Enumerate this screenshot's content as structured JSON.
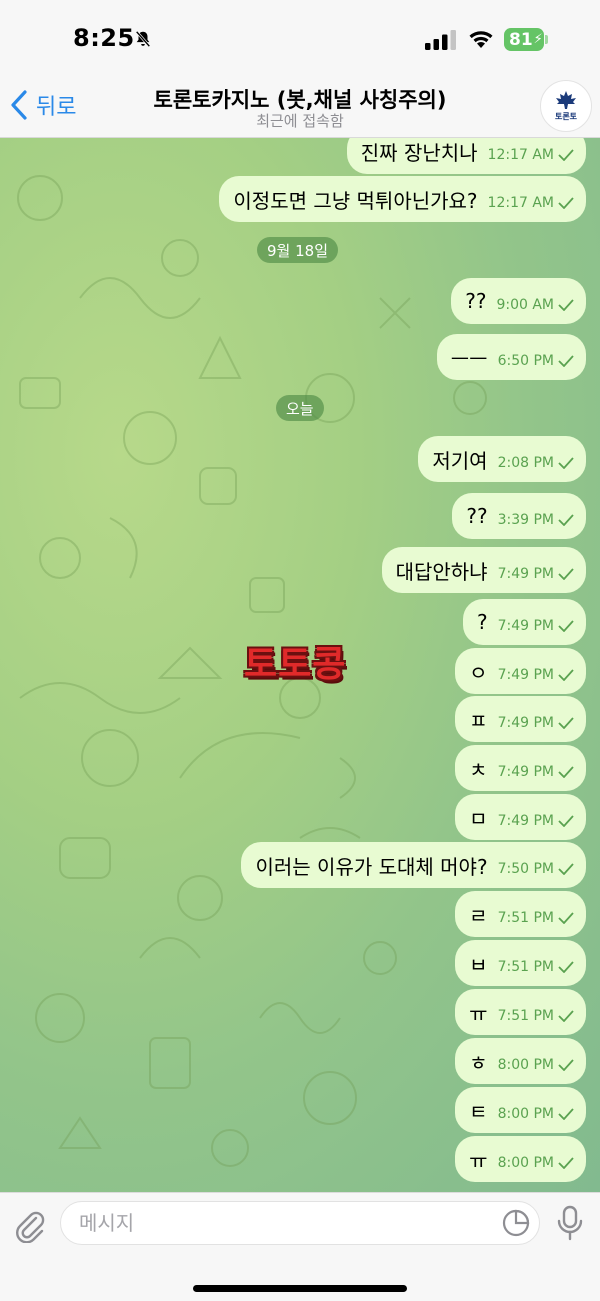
{
  "status_bar": {
    "time": "8:25",
    "battery": "81",
    "icons": [
      "bell-slash-icon",
      "cellular-signal-icon",
      "wifi-icon",
      "battery-icon",
      "charging-bolt-icon"
    ]
  },
  "header": {
    "back_label": "뒤로",
    "title": "토론토카지노 (봇,채널 사칭주의)",
    "status": "최근에 접속함",
    "avatar_text": "토론토"
  },
  "colors": {
    "accent": "#2a89e8",
    "bubble_out": "#e8fbd2",
    "meta_text": "#5aa250",
    "date_chip": "#6a9e5e",
    "sticker_red": "#e02a2a"
  },
  "chat": {
    "date_separators": [
      {
        "label": "9월 18일"
      },
      {
        "label": "오늘"
      }
    ],
    "sticker_text": "토토콩",
    "messages": [
      {
        "text": "진짜 장난치나",
        "time": "12:17 AM",
        "read": true
      },
      {
        "text": "이정도면 그냥 먹튀아닌가요?",
        "time": "12:17 AM",
        "read": true
      },
      {
        "text": "??",
        "time": "9:00 AM",
        "read": true
      },
      {
        "text": "ㅡㅡ",
        "time": "6:50 PM",
        "read": true
      },
      {
        "text": "저기여",
        "time": "2:08 PM",
        "read": true
      },
      {
        "text": "??",
        "time": "3:39 PM",
        "read": true
      },
      {
        "text": "대답안하냐",
        "time": "7:49 PM",
        "read": true
      },
      {
        "text": "?",
        "time": "7:49 PM",
        "read": true
      },
      {
        "text": "ㅇ",
        "time": "7:49 PM",
        "read": true
      },
      {
        "text": "ㅍ",
        "time": "7:49 PM",
        "read": true
      },
      {
        "text": "ㅊ",
        "time": "7:49 PM",
        "read": true
      },
      {
        "text": "ㅁ",
        "time": "7:49 PM",
        "read": true
      },
      {
        "text": "이러는 이유가 도대체 머야?",
        "time": "7:50 PM",
        "read": true
      },
      {
        "text": "ㄹ",
        "time": "7:51 PM",
        "read": true
      },
      {
        "text": "ㅂ",
        "time": "7:51 PM",
        "read": true
      },
      {
        "text": "ㅠ",
        "time": "7:51 PM",
        "read": true
      },
      {
        "text": "ㅎ",
        "time": "8:00 PM",
        "read": true
      },
      {
        "text": "ㅌ",
        "time": "8:00 PM",
        "read": true
      },
      {
        "text": "ㅠ",
        "time": "8:00 PM",
        "read": true
      }
    ]
  },
  "composer": {
    "placeholder": "메시지",
    "value": ""
  }
}
